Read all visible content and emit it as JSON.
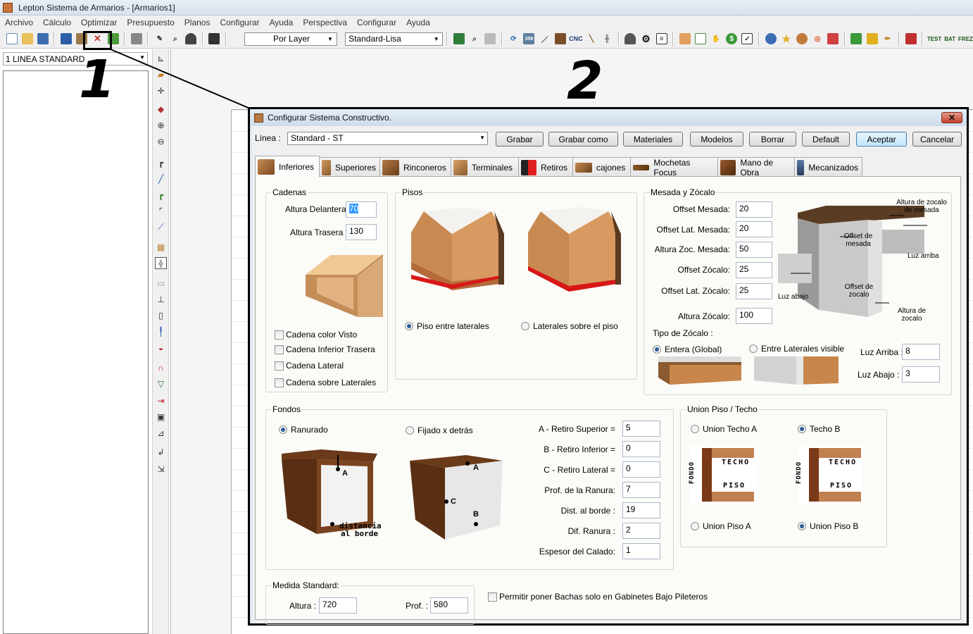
{
  "app": {
    "title": "Lepton Sistema de Armarios - [Armarios1]",
    "menu": [
      "Archivo",
      "Cálculo",
      "Optimizar",
      "Presupuesto",
      "Planos",
      "Configurar",
      "Ayuda",
      "Perspectiva",
      "Configurar",
      "Ayuda"
    ],
    "toolbar": {
      "layer_select": "Por Layer",
      "style_select": "Standard-Lisa",
      "text_buttons": [
        "CNC",
        "TEST",
        "BAT",
        "FREZ"
      ]
    },
    "left_panel": {
      "line_combo": "1 LINEA STANDARD"
    }
  },
  "annotations": {
    "step1": "1",
    "step2": "2"
  },
  "dialog": {
    "title": "Configurar Sistema Constructivo.",
    "close_glyph": "✕",
    "linea_label": "Línea :",
    "linea_value": "Standard - ST",
    "buttons": {
      "grabar": "Grabar",
      "grabar_como": "Grabar como",
      "materiales": "Materiales",
      "modelos": "Modelos",
      "borrar": "Borrar",
      "default": "Default",
      "aceptar": "Aceptar",
      "cancelar": "Cancelar"
    },
    "tabs": [
      "Inferiores",
      "Superiores",
      "Rinconeros",
      "Terminales",
      "Retiros",
      "cajones",
      "Mochetas Focus",
      "Mano de Obra",
      "Mecanizados"
    ],
    "cadenas": {
      "title": "Cadenas",
      "delantera_label": "Altura Delantera:",
      "delantera_value": "70",
      "trasera_label": "Altura Trasera :",
      "trasera_value": "130",
      "checks": [
        "Cadena color Visto",
        "Cadena Inferior Trasera",
        "Cadena Lateral",
        "Cadena sobre Laterales"
      ]
    },
    "pisos": {
      "title": "Pisos",
      "option_a": "Piso entre laterales",
      "option_b": "Laterales sobre el piso"
    },
    "mesada": {
      "title": "Mesada y Zócalo",
      "fields": [
        {
          "label": "Offset Mesada:",
          "value": "20"
        },
        {
          "label": "Offset Lat. Mesada:",
          "value": "20"
        },
        {
          "label": "Altura Zoc. Mesada:",
          "value": "50"
        },
        {
          "label": "Offset Zócalo:",
          "value": "25"
        },
        {
          "label": "Offset Lat. Zócalo:",
          "value": "25"
        },
        {
          "label": "Altura Zócalo:",
          "value": "100"
        }
      ],
      "tipo_label": "Tipo de Zócalo :",
      "tipo_a": "Entera (Global)",
      "tipo_b": "Entre Laterales visible",
      "luz_arriba_label": "Luz Arriba :",
      "luz_arriba_value": "8",
      "luz_abajo_label": "Luz Abajo :",
      "luz_abajo_value": "3",
      "diagram_labels": {
        "altura_zocalo_mesada": "Altura de zocalo de mesada",
        "offset_mesada": "Offset de mesada",
        "luz_arriba": "Luz arriba",
        "luz_abajo": "Luz abajo",
        "offset_zocalo": "Offset de zocalo",
        "altura_zocalo": "Altura de zocalo"
      }
    },
    "fondos": {
      "title": "Fondos",
      "option_a": "Ranurado",
      "option_b": "Fijado x detrás",
      "fields": [
        {
          "label": "A - Retiro Superior =",
          "value": "5"
        },
        {
          "label": "B - Retiro Inferior =",
          "value": "0"
        },
        {
          "label": "C - Retiro Lateral  =",
          "value": "0"
        },
        {
          "label": "Prof. de la Ranura:",
          "value": "7"
        },
        {
          "label": "Dist. al borde :",
          "value": "19"
        },
        {
          "label": "Dif. Ranura :",
          "value": "2"
        },
        {
          "label": "Espesor del Calado:",
          "value": "1"
        }
      ],
      "diagram_labels": {
        "a": "A",
        "b": "B",
        "c": "C",
        "distancia": "distancia",
        "al_borde": "al borde"
      }
    },
    "union": {
      "title": "Union Piso / Techo",
      "techo_a": "Union Techo A",
      "techo_b": "Techo B",
      "piso_a": "Union Piso A",
      "piso_b": "Union Piso B",
      "diagram_labels": {
        "techo": "TECHO",
        "piso": "PISO",
        "fondo": "FONDO"
      }
    },
    "medida": {
      "title": "Medida Standard:",
      "altura_label": "Altura :",
      "altura_value": "720",
      "prof_label": "Prof. :",
      "prof_value": "580"
    },
    "bachas_label": "Permitir poner Bachas solo en Gabinetes Bajo Pileteros"
  }
}
